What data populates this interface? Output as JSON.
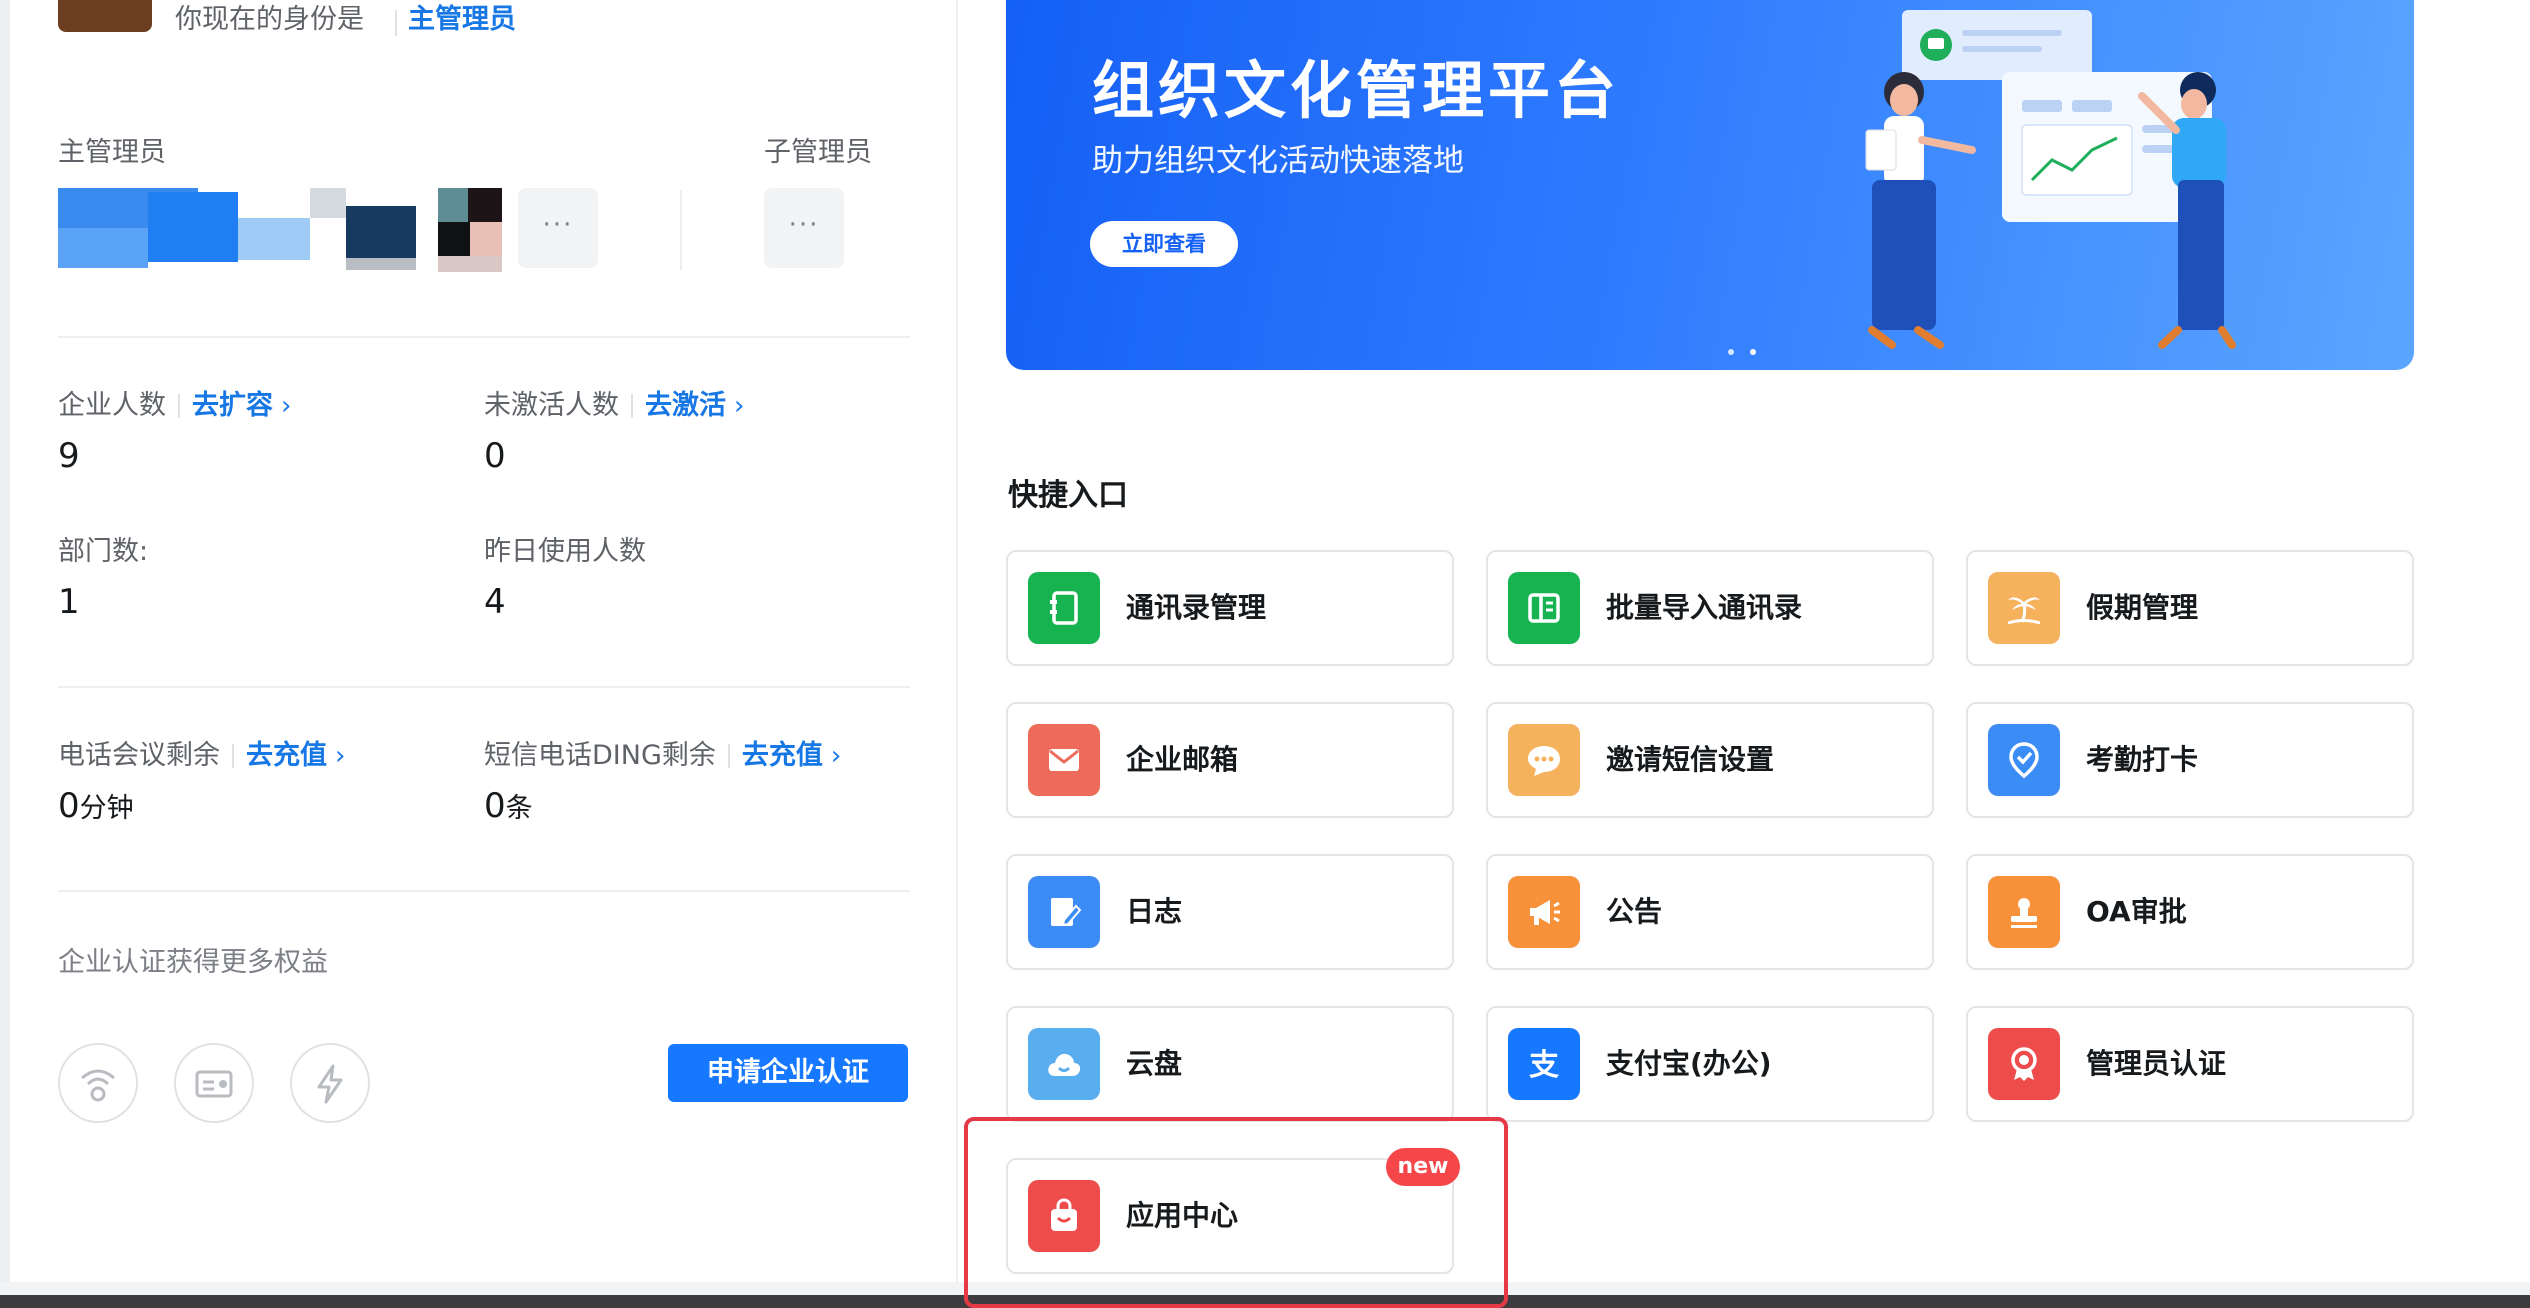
{
  "identity": {
    "prefix": "你现在的身份是",
    "role": "主管理员"
  },
  "admins": {
    "main_label": "主管理员",
    "sub_label": "子管理员",
    "more_label": "···"
  },
  "stats": [
    {
      "label": "企业人数",
      "link": "去扩容",
      "value": "9"
    },
    {
      "label": "未激活人数",
      "link": "去激活",
      "value": "0"
    },
    {
      "label": "部门数:",
      "value": "1"
    },
    {
      "label": "昨日使用人数",
      "value": "4"
    },
    {
      "label": "电话会议剩余",
      "link": "去充值",
      "value": "0",
      "unit": "分钟"
    },
    {
      "label": "短信电话DING剩余",
      "link": "去充值",
      "value": "0",
      "unit": "条"
    }
  ],
  "certification": {
    "title": "企业认证获得更多权益",
    "button": "申请企业认证",
    "icons": [
      "wifi-seal-icon",
      "id-card-icon",
      "lightning-icon"
    ]
  },
  "banner": {
    "title": "组织文化管理平台",
    "subtitle": "助力组织文化活动快速落地",
    "button": "立即查看",
    "dot_count": 2
  },
  "quick_access": {
    "title": "快捷入口",
    "items": [
      {
        "label": "通讯录管理",
        "icon": "address-book-icon",
        "color": "#16b350"
      },
      {
        "label": "批量导入通讯录",
        "icon": "import-book-icon",
        "color": "#16b350"
      },
      {
        "label": "假期管理",
        "icon": "palm-tree-icon",
        "color": "#f5b15b"
      },
      {
        "label": "企业邮箱",
        "icon": "mail-icon",
        "color": "#ee6a5a"
      },
      {
        "label": "邀请短信设置",
        "icon": "chat-bubble-icon",
        "color": "#f5b15b"
      },
      {
        "label": "考勤打卡",
        "icon": "location-check-icon",
        "color": "#3b8cf5"
      },
      {
        "label": "日志",
        "icon": "edit-note-icon",
        "color": "#3b8cf5"
      },
      {
        "label": "公告",
        "icon": "megaphone-icon",
        "color": "#f7913a"
      },
      {
        "label": "OA审批",
        "icon": "stamp-icon",
        "color": "#f7913a"
      },
      {
        "label": "云盘",
        "icon": "cloud-icon",
        "color": "#59aef0"
      },
      {
        "label": "支付宝(办公)",
        "icon": "alipay-icon",
        "color": "#1677ff"
      },
      {
        "label": "管理员认证",
        "icon": "badge-ribbon-icon",
        "color": "#ee4b4b"
      },
      {
        "label": "应用中心",
        "icon": "shopping-bag-icon",
        "color": "#ee4b4b",
        "badge": "new"
      }
    ]
  }
}
